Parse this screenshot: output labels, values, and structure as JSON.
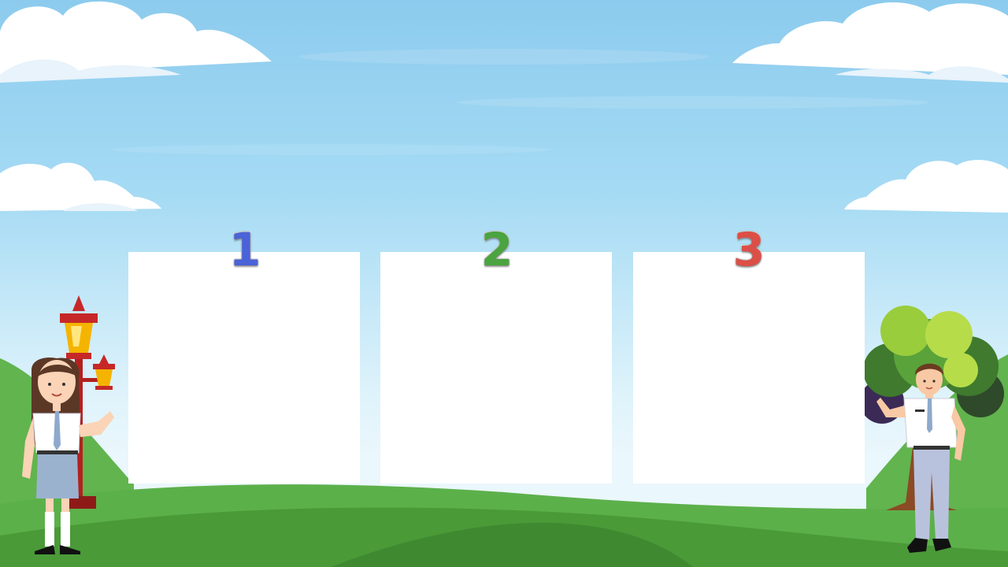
{
  "slide": {
    "boxes": [
      {
        "number": "1",
        "color": "#4a63d8"
      },
      {
        "number": "2",
        "color": "#4aa43f"
      },
      {
        "number": "3",
        "color": "#dc4f47"
      }
    ]
  },
  "illustration": {
    "characters": [
      "girl-student-icon",
      "boy-student-icon"
    ],
    "scenery": [
      "cloud-icon",
      "street-lamp-icon",
      "tree-icon",
      "hill-icon"
    ]
  }
}
